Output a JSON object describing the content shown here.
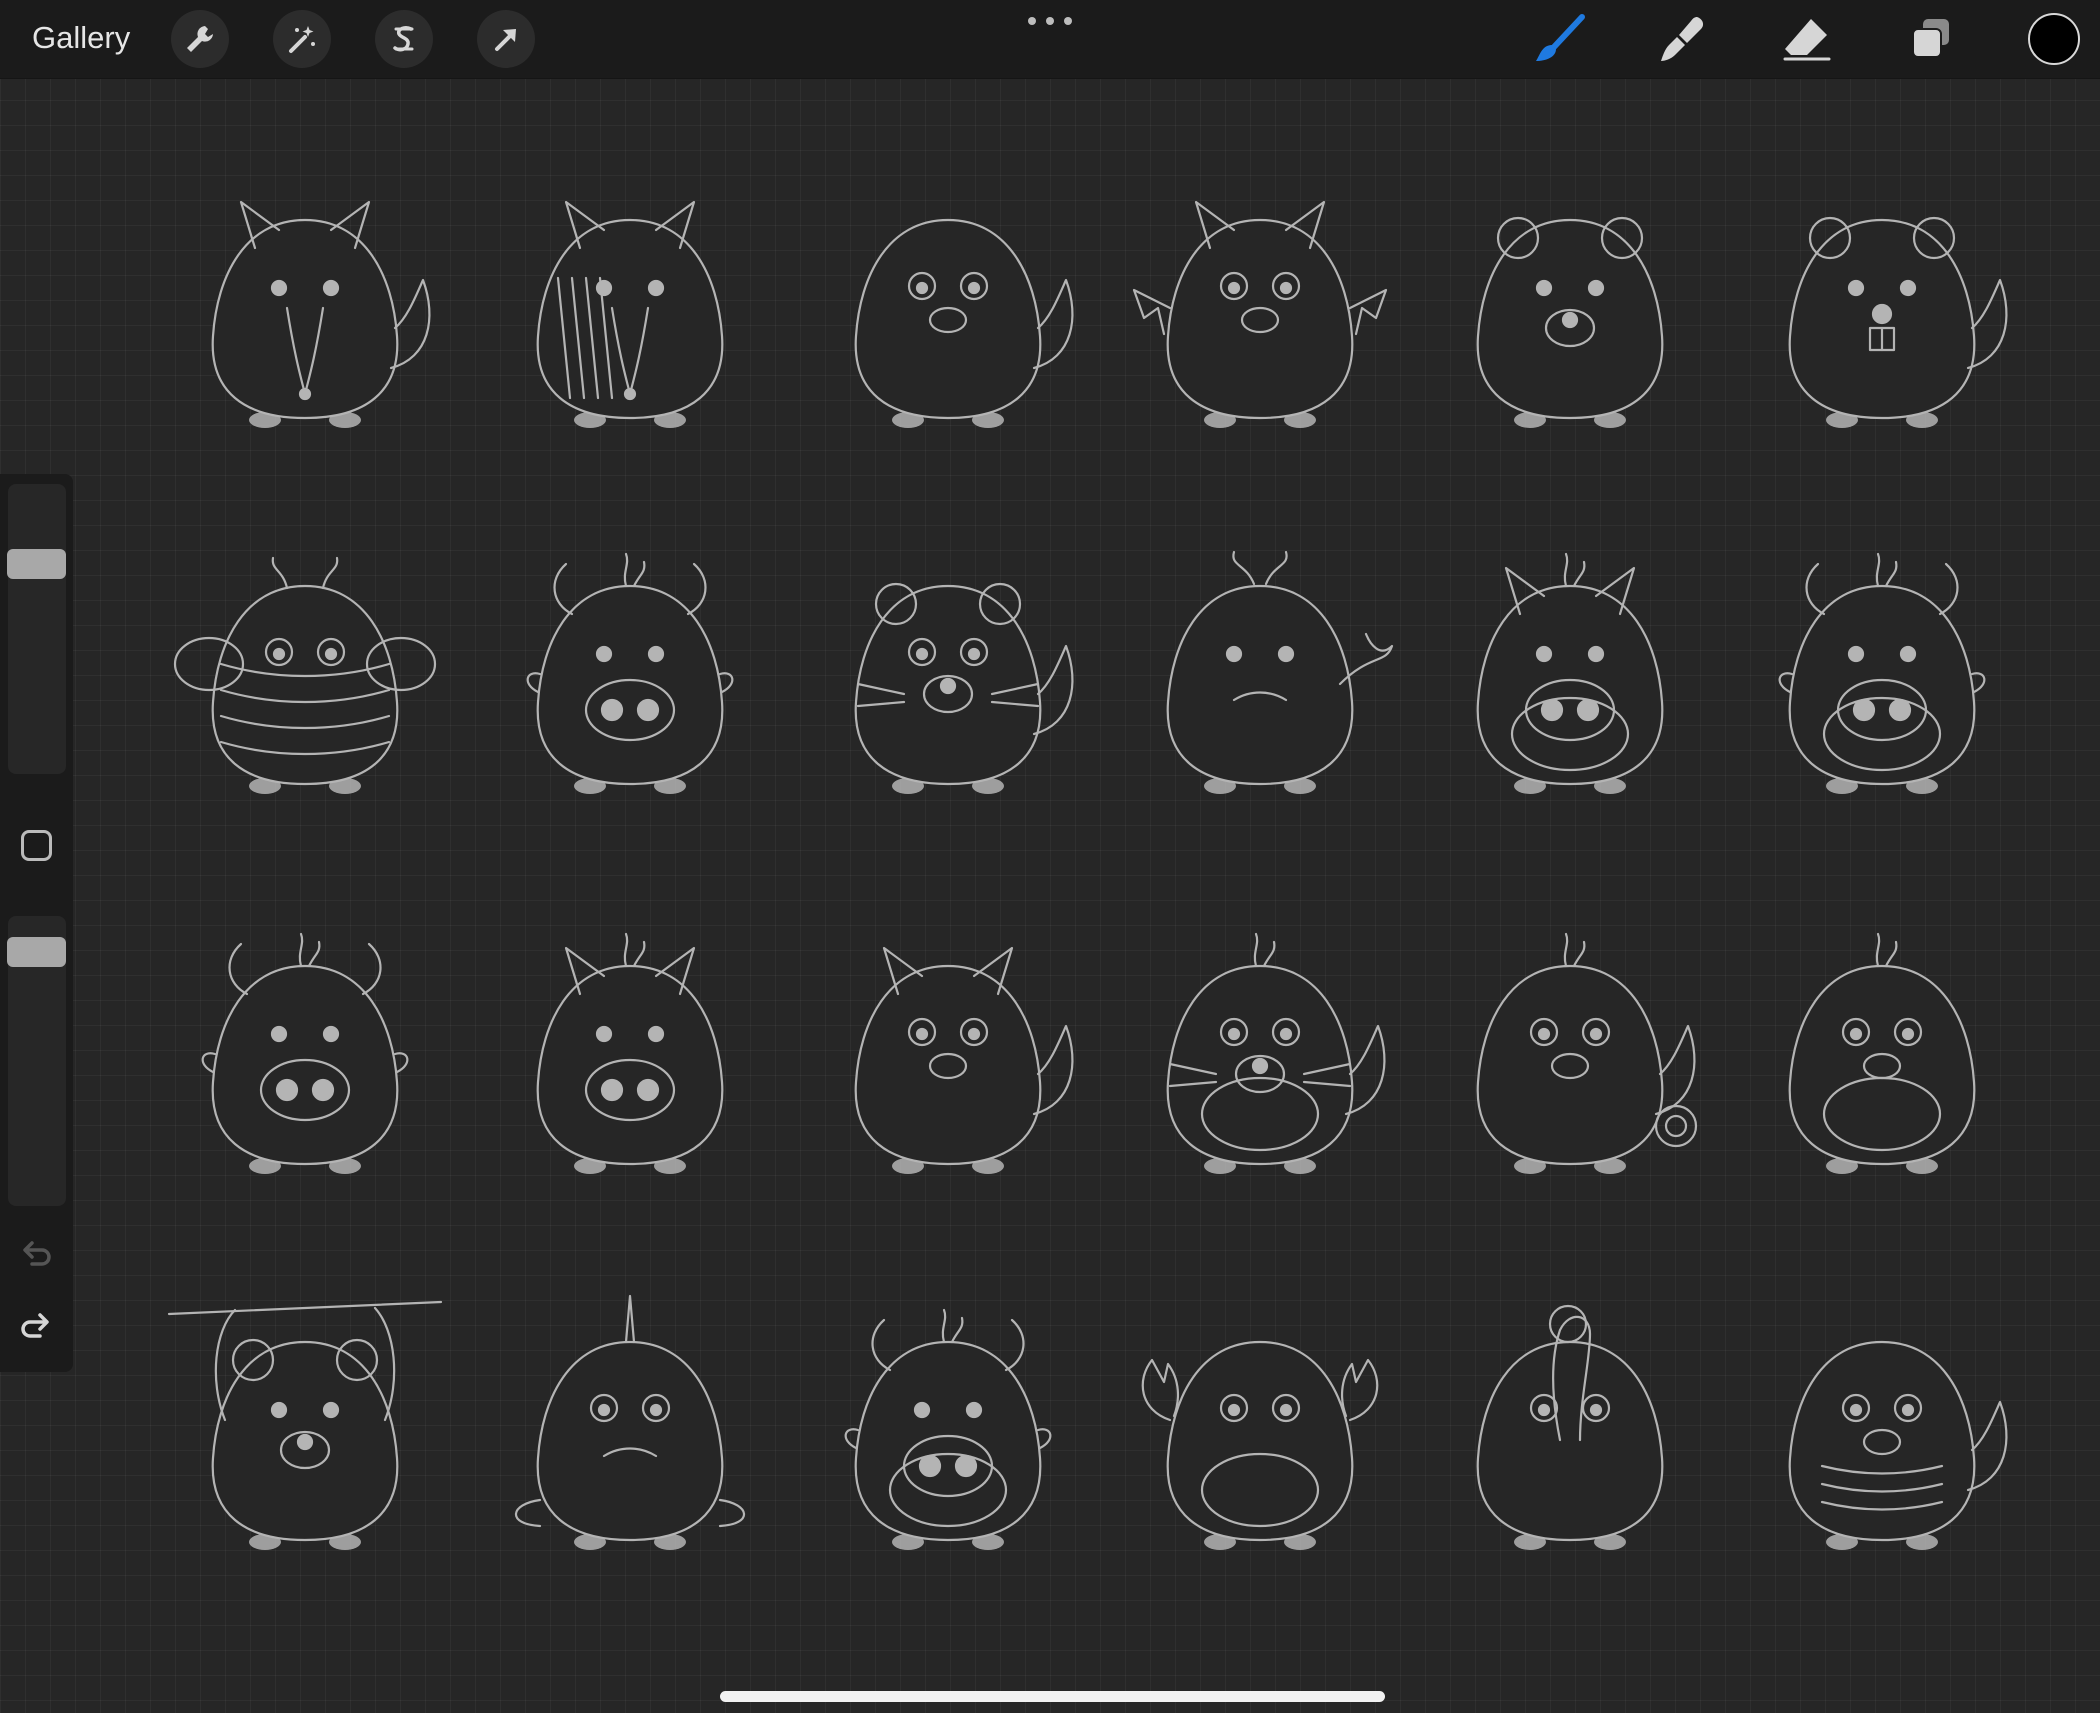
{
  "topbar": {
    "gallery_label": "Gallery",
    "left_tools": [
      "wrench-icon",
      "magic-wand-icon",
      "selection-icon",
      "transform-arrow-icon"
    ],
    "right_tools": [
      "brush-icon",
      "smudge-icon",
      "eraser-icon",
      "layers-icon"
    ],
    "active_tool": "brush-icon",
    "current_color": "#000000",
    "accent_color": "#1f7ae0"
  },
  "sidebar": {
    "brush_size_level": 0.75,
    "opacity_level": 0.92,
    "undo_icon": "undo-icon",
    "redo_icon": "redo-icon"
  },
  "canvas": {
    "background_color": "#262626",
    "line_color": "#b4b4b4",
    "rows": [
      [
        "anteater",
        "armadillo",
        "chipmunk",
        "bat",
        "bear",
        "beaver"
      ],
      [
        "bee",
        "bull",
        "cat",
        "whale",
        "boar",
        "cow"
      ],
      [
        "ox",
        "camel",
        "fennec-fox",
        "walrus-cat",
        "chameleon",
        "chick"
      ],
      [
        "monkey",
        "narwhal",
        "bison",
        "crab",
        "flamingo",
        "crocodile"
      ]
    ]
  }
}
